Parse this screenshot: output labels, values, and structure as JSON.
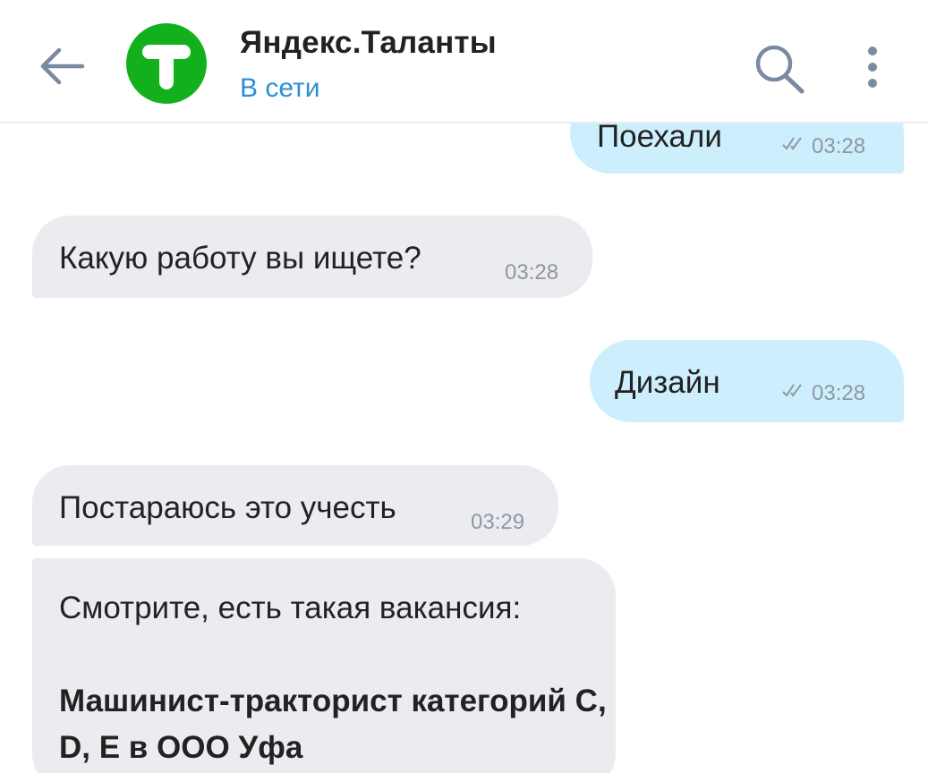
{
  "header": {
    "contact_name": "Яндекс.Таланты",
    "status": "В сети",
    "avatar_letter": "Т",
    "avatar_color": "#13b01e",
    "back_icon": "arrow-left-icon",
    "search_icon": "search-icon",
    "menu_icon": "more-vertical-icon"
  },
  "messages": [
    {
      "direction": "out",
      "text": "Поехали",
      "time": "03:28",
      "read": true
    },
    {
      "direction": "in",
      "text": "Какую работу вы ищете?",
      "time": "03:28"
    },
    {
      "direction": "out",
      "text": "Дизайн",
      "time": "03:28",
      "read": true
    },
    {
      "direction": "in",
      "text": "Постараюсь это учесть",
      "time": "03:29"
    },
    {
      "direction": "in",
      "intro": "Смотрите, есть такая вакансия:",
      "vacancy_title": "Машинист-тракторист категорий C, D, E  в ООО Уфа"
    }
  ],
  "colors": {
    "incoming_bubble": "#ebebf0",
    "outgoing_bubble": "#cdeefc",
    "status_blue": "#2c8fd4",
    "timestamp": "#8c98a4"
  }
}
